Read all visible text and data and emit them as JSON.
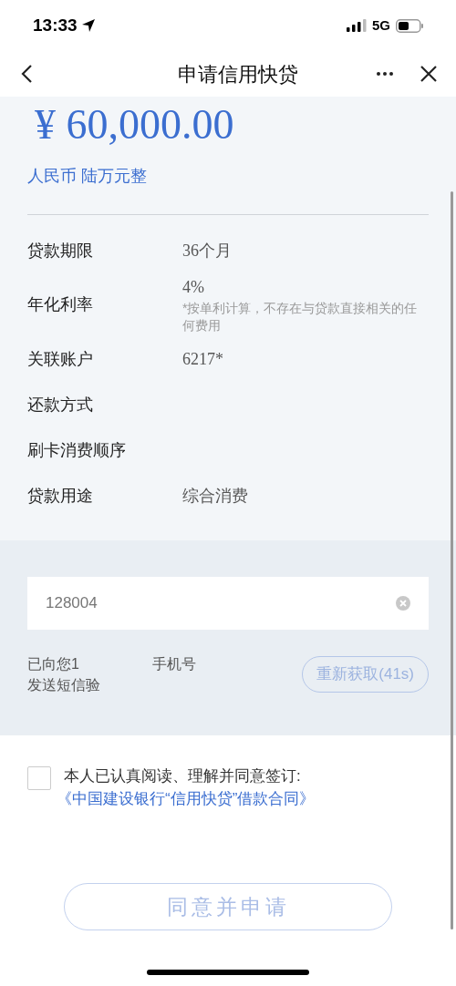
{
  "status_bar": {
    "time": "13:33",
    "network": "5G"
  },
  "nav": {
    "title": "申请信用快贷"
  },
  "amount": {
    "value": "¥ 60,000.00",
    "words": "人民币 陆万元整"
  },
  "details": [
    {
      "label": "贷款期限",
      "value": "36个月"
    },
    {
      "label": "年化利率",
      "value": "4%",
      "note": "*按单利计算，不存在与贷款直接相关的任何费用"
    },
    {
      "label": "关联账户",
      "value": "6217*"
    },
    {
      "label": "还款方式"
    },
    {
      "label": "刷卡消费顺序"
    },
    {
      "label": "贷款用途",
      "value": "综合消费"
    }
  ],
  "verification": {
    "code": "128004",
    "hint_line_1_start": "已向您1",
    "hint_line_1_end": "手机号",
    "hint_line_2": "发送短信验",
    "resend_button": "重新获取(41s)"
  },
  "agreement": {
    "checked": false,
    "text": "本人已认真阅读、理解并同意签订:",
    "link": "《中国建设银行“信用快贷”借款合同》"
  },
  "submit_button": {
    "label": "同意并申请",
    "disabled": true
  }
}
